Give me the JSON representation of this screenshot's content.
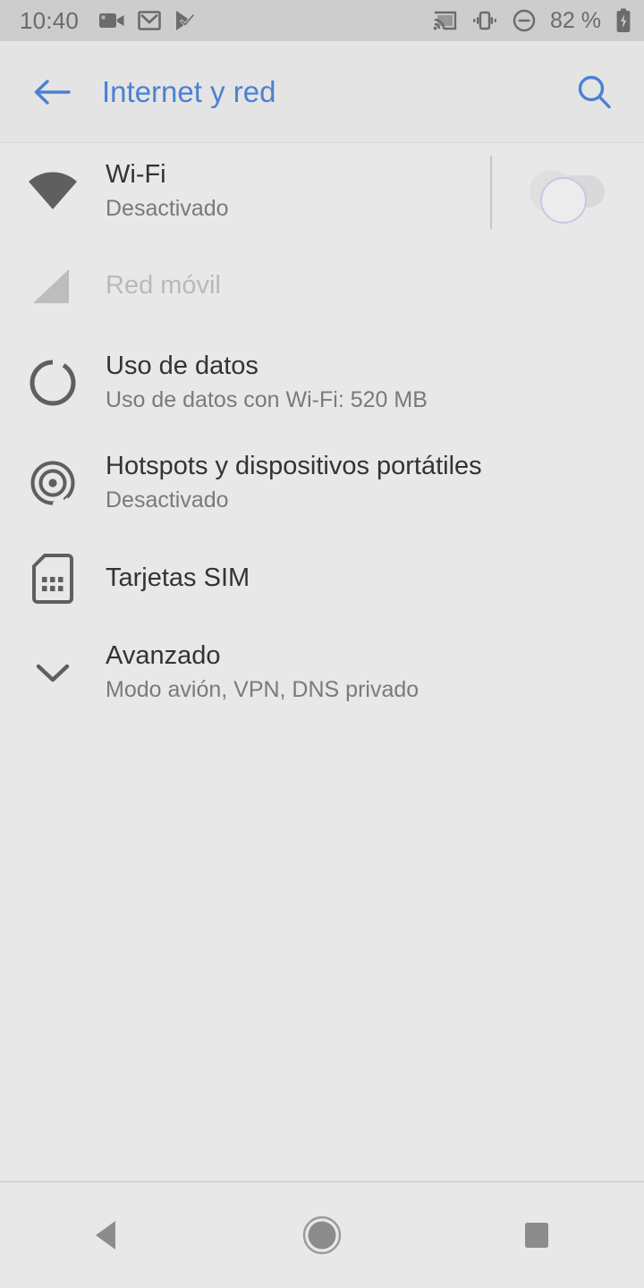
{
  "status_bar": {
    "clock": "10:40",
    "battery_percent": "82 %",
    "left_icons": [
      "video-camera-icon",
      "gmail-icon",
      "play-store-checkmark-icon"
    ],
    "right_icons": [
      "cast-icon",
      "vibrate-icon",
      "do-not-disturb-icon",
      "battery-charging-icon"
    ],
    "background_color": "#cdcdcd",
    "text_color": "#6b6b6b"
  },
  "app_bar": {
    "title": "Internet y red",
    "back_icon": "arrow-left-icon",
    "search_icon": "search-icon",
    "accent_color": "#4a81d4",
    "background_color": "#e4e4e4"
  },
  "settings_list": [
    {
      "key": "wifi",
      "icon": "wifi-icon",
      "title": "Wi-Fi",
      "subtitle": "Desactivado",
      "enabled": true,
      "has_toggle": true,
      "toggle_state": "off"
    },
    {
      "key": "mobile_network",
      "icon": "signal-cellular-icon",
      "title": "Red móvil",
      "subtitle": "",
      "enabled": false,
      "has_toggle": false,
      "toggle_state": ""
    },
    {
      "key": "data_usage",
      "icon": "data-usage-icon",
      "title": "Uso de datos",
      "subtitle": "Uso de datos con Wi-Fi: 520 MB",
      "enabled": true,
      "has_toggle": false,
      "toggle_state": ""
    },
    {
      "key": "hotspot",
      "icon": "hotspot-icon",
      "title": "Hotspots y dispositivos portátiles",
      "subtitle": "Desactivado",
      "enabled": true,
      "has_toggle": false,
      "toggle_state": ""
    },
    {
      "key": "sim_cards",
      "icon": "sim-card-icon",
      "title": "Tarjetas SIM",
      "subtitle": "",
      "enabled": true,
      "has_toggle": false,
      "toggle_state": ""
    },
    {
      "key": "advanced",
      "icon": "chevron-down-icon",
      "title": "Avanzado",
      "subtitle": "Modo avión, VPN, DNS privado",
      "enabled": true,
      "has_toggle": false,
      "toggle_state": ""
    }
  ],
  "nav_bar": {
    "back_icon": "nav-back-triangle-icon",
    "home_icon": "nav-home-circle-icon",
    "recents_icon": "nav-recents-square-icon"
  },
  "theme": {
    "page_background": "#e8e8e8",
    "title_text_color": "#333333",
    "subtitle_text_color": "#7a7a7a",
    "disabled_text_color": "#b9b9b9",
    "icon_color": "#5f5f5f"
  }
}
